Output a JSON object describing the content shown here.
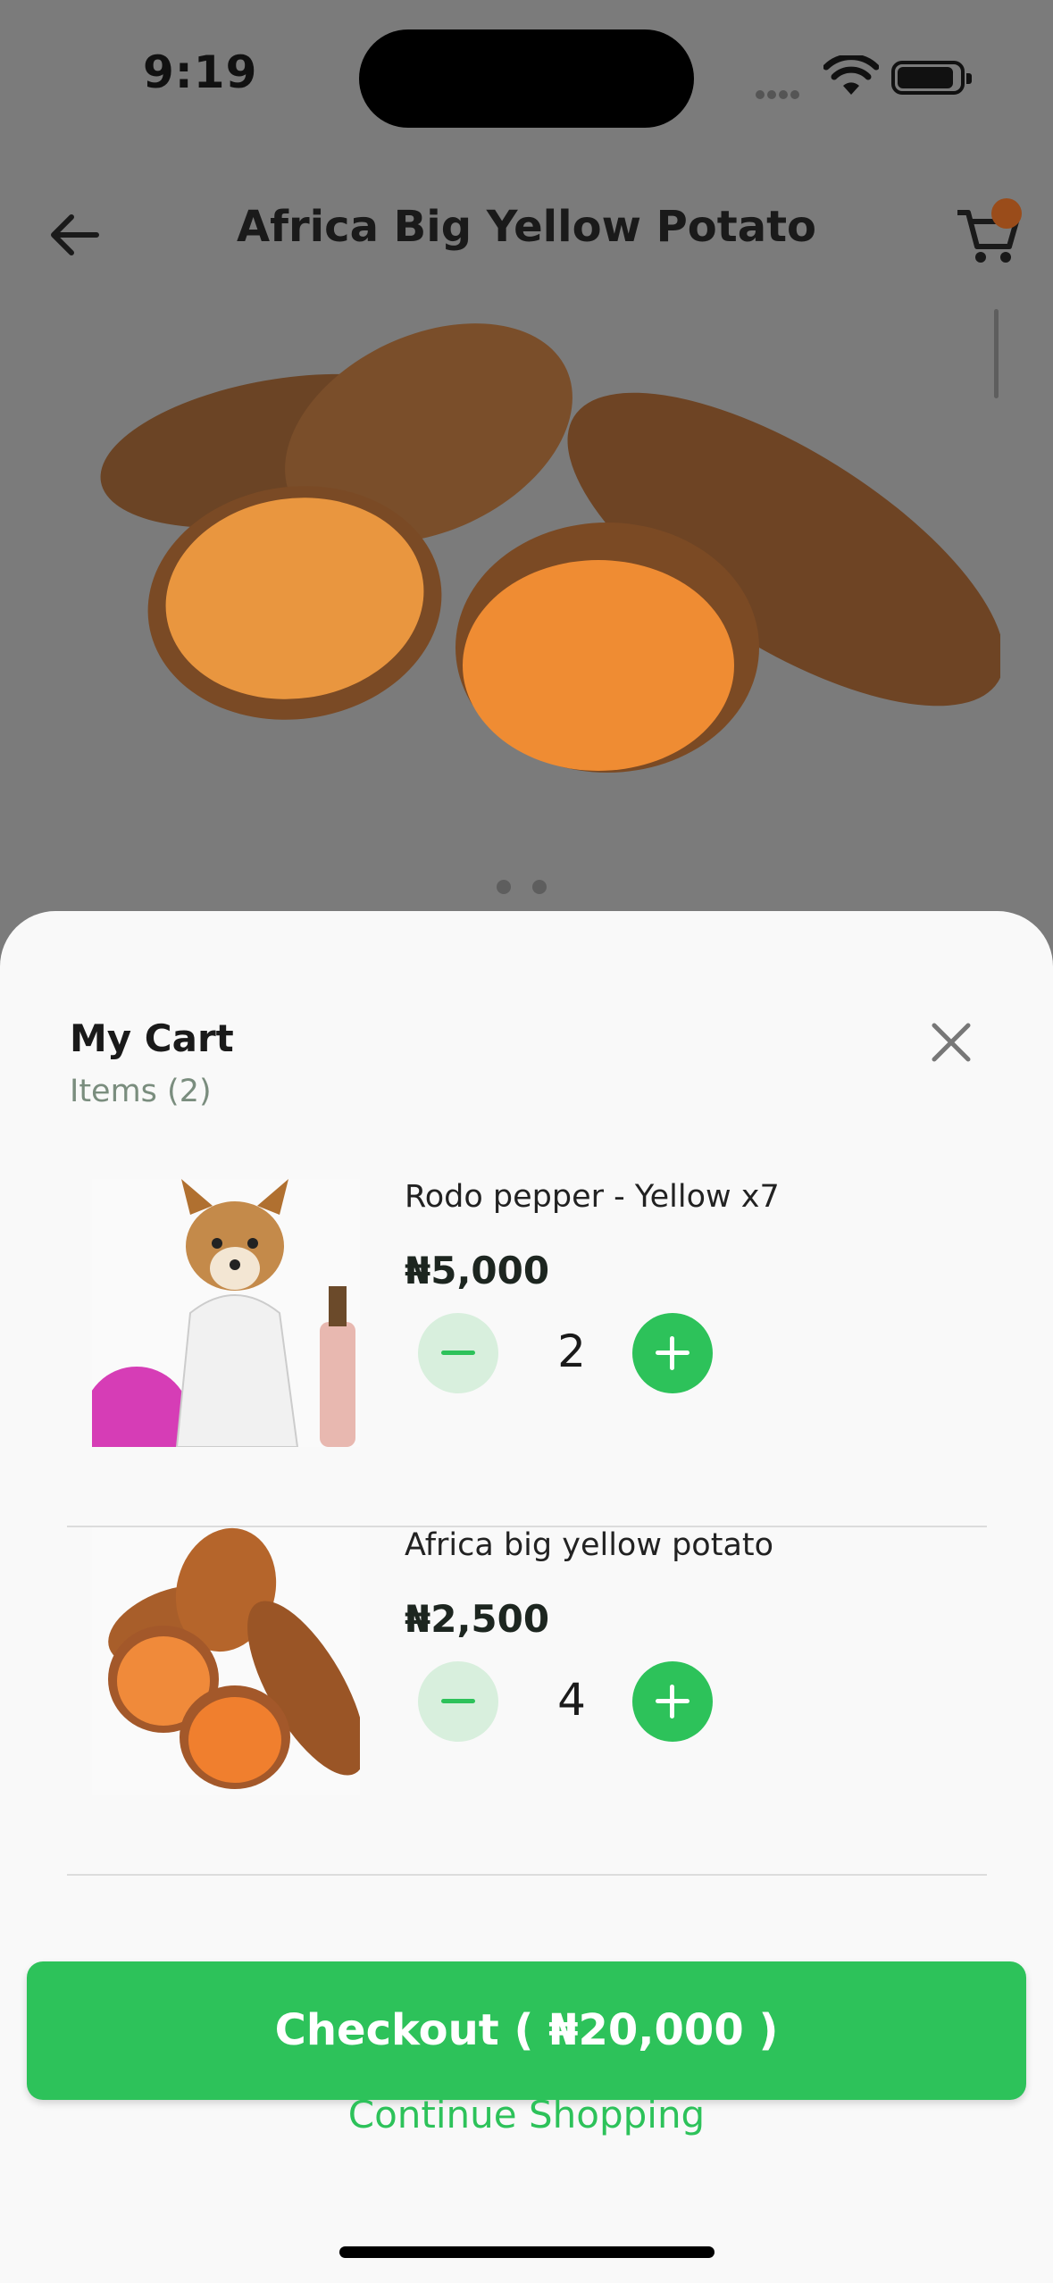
{
  "status_bar": {
    "time": "9:19"
  },
  "header": {
    "title": "Africa Big Yellow Potato",
    "back_icon": "arrow-left-icon",
    "cart_icon": "cart-icon"
  },
  "cart": {
    "title": "My Cart",
    "count_label": "Items (2)",
    "items": [
      {
        "name": "Rodo pepper - Yellow x7",
        "price": "₦5,000",
        "quantity": "2"
      },
      {
        "name": "Africa big yellow potato",
        "price": "₦2,500",
        "quantity": "4"
      }
    ],
    "checkout_label": "Checkout ( ₦20,000 )",
    "continue_label": "Continue Shopping"
  },
  "colors": {
    "accent": "#2dc25a",
    "accent_light": "#d8efdd",
    "overlay": "#7b7b7b",
    "sheet": "#f9f9f9"
  }
}
